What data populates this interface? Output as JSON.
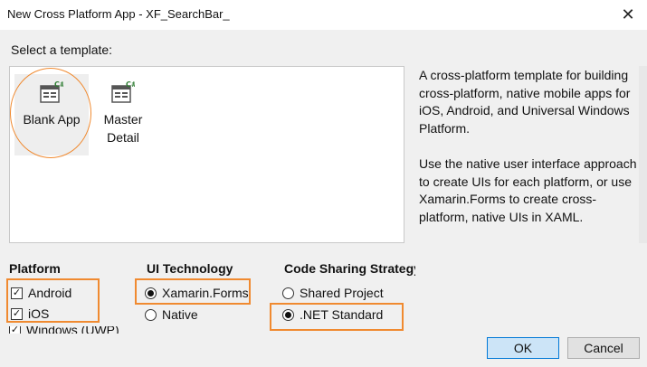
{
  "window": {
    "title": "New Cross Platform App - XF_SearchBar_",
    "close_glyph": "✕"
  },
  "templates": {
    "label": "Select a template:",
    "items": [
      {
        "label_line1": "Blank App",
        "label_line2": "",
        "icon": "csharp-form-icon",
        "selected": true
      },
      {
        "label_line1": "Master",
        "label_line2": "Detail",
        "icon": "csharp-form-icon",
        "selected": false
      }
    ]
  },
  "description": {
    "paragraph1": "A cross-platform template for building cross-platform, native mobile apps for iOS, Android, and Universal Windows Platform.",
    "paragraph2": "Use the native user interface approach to create UIs for each platform, or use Xamarin.Forms to create cross-platform, native UIs in XAML."
  },
  "platform": {
    "title": "Platform",
    "options": [
      {
        "label": "Android",
        "checked": true
      },
      {
        "label": "iOS",
        "checked": true
      },
      {
        "label": "Windows (UWP)",
        "checked": true
      }
    ]
  },
  "ui_technology": {
    "title": "UI Technology",
    "options": [
      {
        "label": "Xamarin.Forms",
        "selected": true
      },
      {
        "label": "Native",
        "selected": false
      }
    ]
  },
  "code_sharing": {
    "title": "Code Sharing Strategy",
    "options": [
      {
        "label": "Shared Project",
        "selected": false
      },
      {
        "label": ".NET Standard",
        "selected": true
      }
    ]
  },
  "buttons": {
    "ok": "OK",
    "cancel": "Cancel"
  },
  "colors": {
    "annotation": "#f08a30",
    "primary_button_bg": "#cce4f7",
    "primary_button_border": "#0078d7"
  }
}
